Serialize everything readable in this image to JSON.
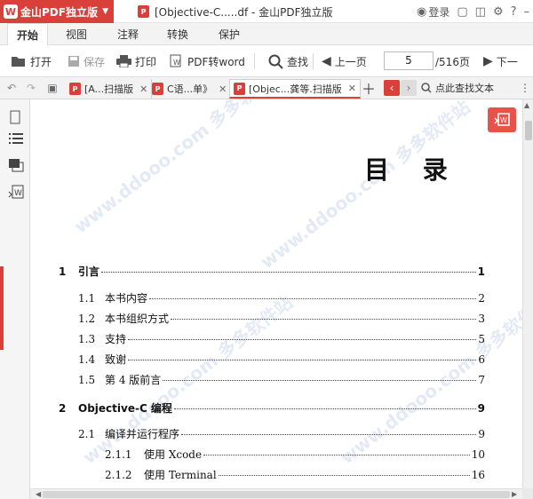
{
  "titlebar": {
    "brand": "金山PDF独立版",
    "window_title": "[Objective-C.....df - 金山PDF独立版",
    "login": "登录"
  },
  "menu_tabs": [
    "开始",
    "视图",
    "注释",
    "转换",
    "保护"
  ],
  "toolbar": {
    "open": "打开",
    "save": "保存",
    "print": "打印",
    "pdf_to_word": "PDF转word",
    "find": "查找",
    "prev_page": "上一页",
    "current_page": "5",
    "total_pages": "/516页",
    "next_page": "下一"
  },
  "doc_tabs": [
    {
      "label": "[A...扫描版"
    },
    {
      "label": "C语...单》"
    },
    {
      "label": "[Objec...龚等.扫描版"
    }
  ],
  "find_in_text": "点此查找文本",
  "document": {
    "heading": "目  录",
    "toc": [
      {
        "num": "1",
        "title": "引言",
        "page": "1",
        "level": "chapter"
      },
      {
        "num": "1.1",
        "title": "本书内容",
        "page": "2",
        "level": "section"
      },
      {
        "num": "1.2",
        "title": "本书组织方式",
        "page": "3",
        "level": "section"
      },
      {
        "num": "1.3",
        "title": "支持",
        "page": "5",
        "level": "section"
      },
      {
        "num": "1.4",
        "title": "致谢",
        "page": "6",
        "level": "section"
      },
      {
        "num": "1.5",
        "title": "第 4 版前言",
        "page": "7",
        "level": "section"
      },
      {
        "num": "2",
        "title": "Objective-C 编程",
        "page": "9",
        "level": "chapter"
      },
      {
        "num": "2.1",
        "title": "编译并运行程序",
        "page": "9",
        "level": "section"
      },
      {
        "num": "2.1.1",
        "title": "使用 Xcode",
        "page": "10",
        "level": "subsection"
      },
      {
        "num": "2.1.2",
        "title": "使用 Terminal",
        "page": "16",
        "level": "subsection"
      }
    ]
  },
  "watermark": "www.ddooo.com  多多软件站",
  "colors": {
    "accent": "#d9403a"
  }
}
